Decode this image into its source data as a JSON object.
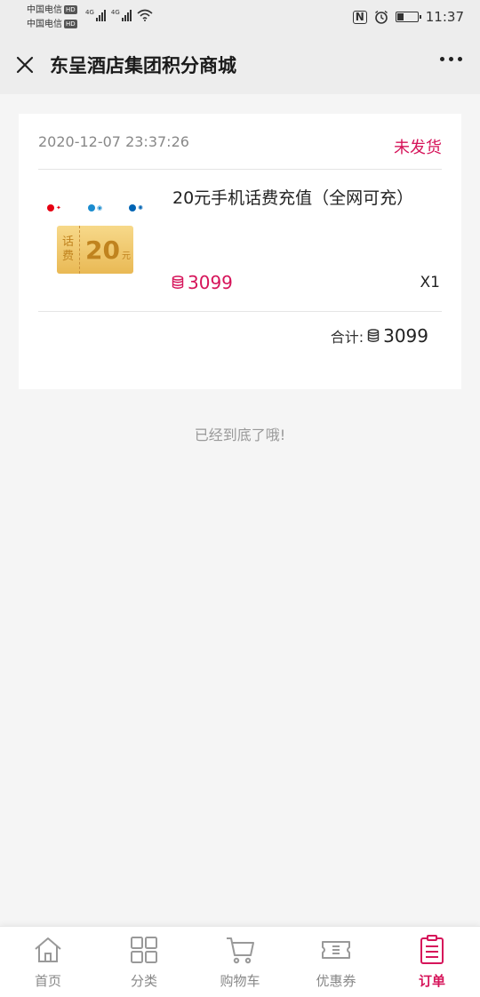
{
  "status_bar": {
    "carrier1": "中国电信",
    "carrier2": "中国电信",
    "hd": "HD",
    "net1": "4G",
    "net2": "4G",
    "nfc": "N",
    "time": "11:37"
  },
  "header": {
    "title": "东呈酒店集团积分商城"
  },
  "order": {
    "datetime": "2020-12-07 23:37:26",
    "status": "未发货",
    "product": {
      "name": "20元手机话费充值（全网可充）",
      "price": "3099",
      "quantity": "X1",
      "image": {
        "voucher_label": [
          "话",
          "费"
        ],
        "voucher_amount": "20",
        "voucher_unit": "元",
        "logos": [
          "china-unicom-logo",
          "china-mobile-logo",
          "china-telecom-logo"
        ]
      }
    },
    "total_label": "合计:",
    "total_value": "3099"
  },
  "end_tip": "已经到底了哦!",
  "nav": {
    "items": [
      {
        "label": "首页",
        "icon": "home-icon"
      },
      {
        "label": "分类",
        "icon": "grid-icon"
      },
      {
        "label": "购物车",
        "icon": "cart-icon"
      },
      {
        "label": "优惠券",
        "icon": "coupon-icon"
      },
      {
        "label": "订单",
        "icon": "order-icon"
      }
    ],
    "active_index": 4
  },
  "colors": {
    "accent": "#d6145a",
    "inactive": "#888888",
    "background": "#f5f5f5"
  }
}
